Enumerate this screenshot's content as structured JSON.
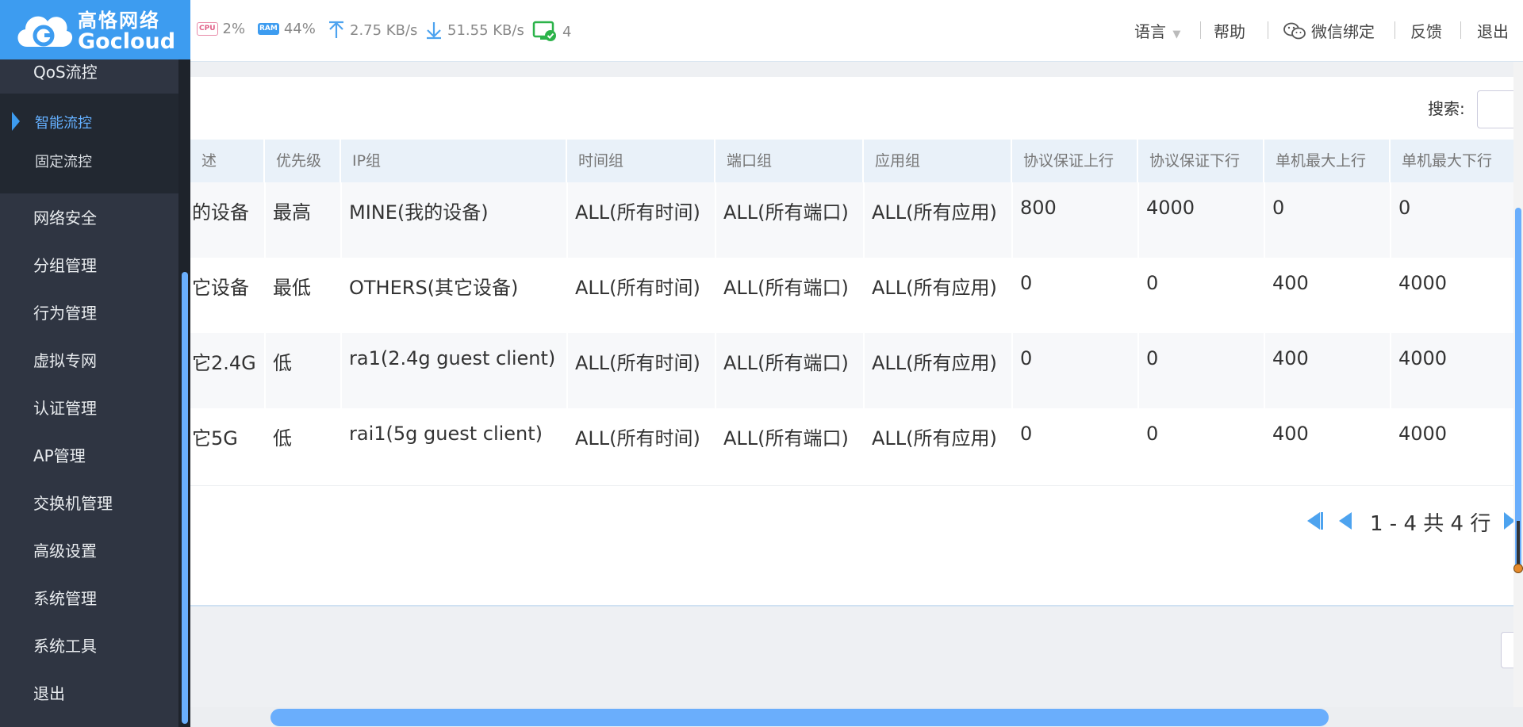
{
  "brand": {
    "name_cn": "高恪网络",
    "name_en": "Gocloud",
    "color": "#3d9cf0"
  },
  "status": {
    "cpu_label": "CPU",
    "cpu": "2%",
    "ram_label": "RAM",
    "ram": "44%",
    "upload": "2.75 KB/s",
    "download": "51.55 KB/s",
    "devices": "4"
  },
  "topnav": {
    "language": "语言",
    "help": "帮助",
    "wechat": "微信绑定",
    "feedback": "反馈",
    "logout": "退出"
  },
  "sidebar": {
    "qos": "QoS流控",
    "sub": [
      "智能流控",
      "固定流控"
    ],
    "items": [
      "网络安全",
      "分组管理",
      "行为管理",
      "虚拟专网",
      "认证管理",
      "AP管理",
      "交换机管理",
      "高级设置",
      "系统管理",
      "系统工具",
      "退出"
    ]
  },
  "search": {
    "label": "搜索:"
  },
  "table": {
    "headers": [
      "述",
      "优先级",
      "IP组",
      "时间组",
      "端口组",
      "应用组",
      "协议保证上行",
      "协议保证下行",
      "单机最大上行",
      "单机最大下行"
    ],
    "rows": [
      [
        "的设备",
        "最高",
        "MINE(我的设备)",
        "ALL(所有时间)",
        "ALL(所有端口)",
        "ALL(所有应用)",
        "800",
        "4000",
        "0",
        "0"
      ],
      [
        "它设备",
        "最低",
        "OTHERS(其它设备)",
        "ALL(所有时间)",
        "ALL(所有端口)",
        "ALL(所有应用)",
        "0",
        "0",
        "400",
        "4000"
      ],
      [
        "它2.4G",
        "低",
        "ra1(2.4g guest client)",
        "ALL(所有时间)",
        "ALL(所有端口)",
        "ALL(所有应用)",
        "0",
        "0",
        "400",
        "4000"
      ],
      [
        "它5G",
        "低",
        "rai1(5g guest client)",
        "ALL(所有时间)",
        "ALL(所有端口)",
        "ALL(所有应用)",
        "0",
        "0",
        "400",
        "4000"
      ]
    ]
  },
  "pager": {
    "text": "1 - 4 共 4 行"
  }
}
